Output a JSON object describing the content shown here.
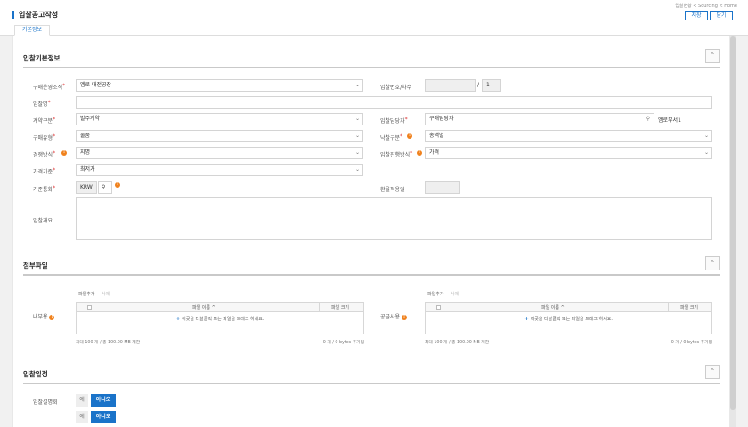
{
  "header": {
    "title": "입찰공고작성",
    "breadcrumb": "입찰현황 < Sourcing < Home",
    "save_label": "저장",
    "close_label": "닫기"
  },
  "tabs": [
    {
      "label": "기본정보",
      "active": true
    }
  ],
  "basic": {
    "section_title": "입찰기본정보",
    "collapse_icon": "«",
    "purchase_org": {
      "label": "구매운영조직",
      "value": "엠로 대전공장"
    },
    "bid_no": {
      "label": "입찰번호/차수",
      "value": "",
      "slash": "/",
      "round": "1"
    },
    "bid_name": {
      "label": "입찰명",
      "value": ""
    },
    "contract_type": {
      "label": "계약구분",
      "value": "발주계약"
    },
    "bid_manager": {
      "label": "입찰담당자",
      "value": "구매담당자",
      "dept": "엠로부서1"
    },
    "purchase_type": {
      "label": "구매유형",
      "value": "물품"
    },
    "award_type": {
      "label": "낙찰구분",
      "value": "총액별"
    },
    "compete_method": {
      "label": "경쟁방식",
      "value": "지명"
    },
    "progress_method": {
      "label": "입찰진행방식",
      "value": "가격"
    },
    "price_basis": {
      "label": "가격기준",
      "value": "최저가"
    },
    "currency": {
      "label": "기준통화",
      "value": "KRW"
    },
    "exchange_rate": {
      "label": "환율적용일",
      "value": ""
    },
    "overview": {
      "label": "입찰개요",
      "value": ""
    }
  },
  "attachments": {
    "section_title": "첨부파일",
    "internal": {
      "label": "내부용",
      "add_label": "파일추가",
      "delete_label": "삭제",
      "col_name": "파일 이름 ^",
      "col_size": "파일 크기",
      "drop_hint": "이곳을 더블클릭 또는 파일을 드래그 하세요.",
      "limit": "최대 100 개 / 총 100.00 MB 제한",
      "total": "0 개 / 0 bytes 추가됨"
    },
    "supplier": {
      "label": "공급사용",
      "add_label": "파일추가",
      "delete_label": "삭제",
      "col_name": "파일 이름 ^",
      "col_size": "파일 크기",
      "drop_hint": "이곳을 더블클릭 또는 파일을 드래그 하세요.",
      "limit": "최대 100 개 / 총 100.00 MB 제한",
      "total": "0 개 / 0 bytes 추가됨"
    }
  },
  "schedule": {
    "section_title": "입찰일정",
    "briefing": {
      "label": "입찰설명회",
      "yes": "예",
      "no": "아니오",
      "selected": "아니오"
    },
    "second_row": {
      "label": "",
      "yes": "예",
      "no": "아니오",
      "selected": "아니오"
    }
  },
  "icons": {
    "chevron": "chevron-down-icon",
    "search": "search-icon",
    "collapse": "collapse-up-icon",
    "plus": "plus-icon",
    "warning": "warning-icon"
  },
  "colors": {
    "accent": "#1a73c9",
    "warning": "#f0821e",
    "required": "#d33333"
  }
}
